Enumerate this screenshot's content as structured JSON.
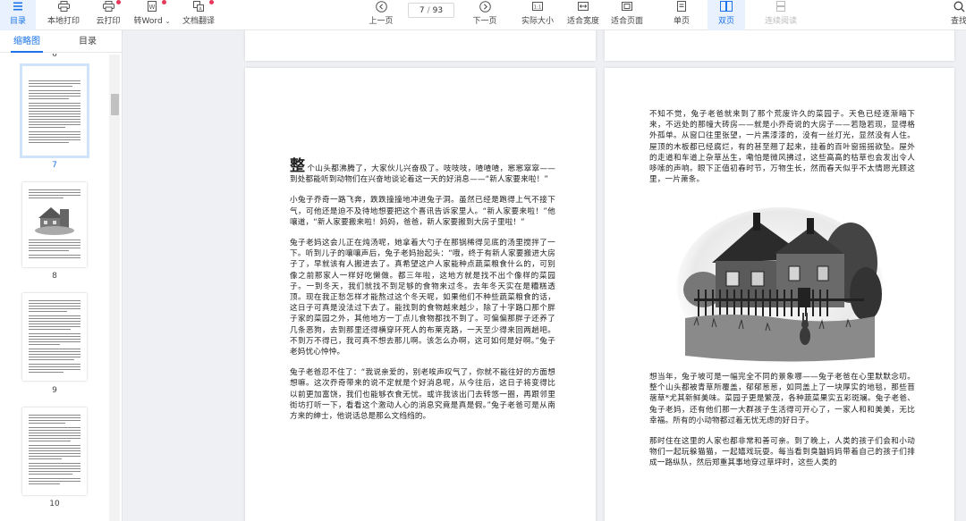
{
  "toolbar": {
    "left_buttons": [
      {
        "label": "目录",
        "icon": "catalog-icon",
        "active": true
      },
      {
        "label": "本地打印",
        "icon": "printer-icon"
      },
      {
        "label": "云打印",
        "icon": "cloud-printer-icon"
      },
      {
        "label": "转Word",
        "icon": "word-icon"
      },
      {
        "label": "文档翻译",
        "icon": "translate-icon"
      }
    ],
    "prev_label": "上一页",
    "next_label": "下一页",
    "current_page": "7",
    "page_sep": "/",
    "total_pages": "93",
    "view_buttons": [
      {
        "label": "实际大小",
        "icon": "actual-size-icon"
      },
      {
        "label": "适合宽度",
        "icon": "fit-width-icon"
      },
      {
        "label": "适合页面",
        "icon": "fit-page-icon"
      },
      {
        "label": "单页",
        "icon": "single-page-icon"
      },
      {
        "label": "双页",
        "icon": "double-page-icon",
        "active": true
      },
      {
        "label": "连续阅读",
        "icon": "continuous-read-icon",
        "disabled": true
      },
      {
        "label": "查找",
        "icon": "search-icon"
      }
    ]
  },
  "sidebar": {
    "tabs": [
      {
        "label": "缩略图",
        "active": true
      },
      {
        "label": "目录"
      }
    ],
    "top_partial_number": "6",
    "thumbnails": [
      {
        "number": "7",
        "selected": true
      },
      {
        "number": "8"
      },
      {
        "number": "9"
      },
      {
        "number": "10"
      }
    ]
  },
  "left_page": {
    "dropcap": "整",
    "paragraphs": [
      "个山头都沸腾了，大家伙儿兴奋极了。吱吱吱，喳喳喳，窸窸窣窣——到处都能听到动物们在兴奋地谈论着这一天的好消息——“新人家要来啦！”",
      "小兔子乔奇一路飞奔，跌跌撞撞地冲进兔子洞。虽然已经是跑得上气不接下气，可他还是迫不及待地想要把这个喜讯告诉家里人。“新人家要来啦！”他嚷道，“新人家要搬来啦！妈妈，爸爸，新人家要搬到大房子里啦！”",
      "兔子老妈这会儿正在炖汤呢，她拿着大勺子在那锅稀得见底的汤里搅拌了一下。听到儿子的嚷嚷声后，兔子老妈抬起头：“哦，终于有新人家要搬进大房子了，早就该有人搬进去了。真希望这户人家能种点蔬菜粮食什么的，可别像之前那家人一样好吃懒做。都三年啦，这地方就是找不出个像样的菜园子。一到冬天，我们就找不到足够的食物来过冬。去年冬天实在是糟糕透顶。现在我正愁怎样才能熬过这个冬天呢，如果他们不种些蔬菜粮食的话，这日子可真是没法过下去了。能找到的食物越来越少，除了十字路口那个胖子家的菜园之外，其他地方一丁点儿食物都找不到了。可偏偏那胖子还养了几条恶狗，去到那里还得横穿环死人的布莱克路，一天至少得来回两趟吧。不到万不得已，我可真不想去那儿啊。该怎么办啊，这可如何是好啊。”兔子老妈忧心忡忡。",
      "兔子老爸忍不住了：“我说亲爱的，别老唉声叹气了，你就不能往好的方面想想嘛。这次乔奇带来的说不定就是个好消息呢，从今往后，这日子将变得比以前更加富饶，我们也能够衣食无忧。或许我该出门去转悠一圈，再跟邻里街坊打听一下，看看这个激动人心的消息究竟是真是假。”兔子老爸可是从南方来的绅士，他说话总是那么文绉绉的。"
    ]
  },
  "right_page": {
    "paragraphs_top": [
      "不知不觉，兔子老爸就来到了那个荒废许久的菜园子。天色已经逐渐暗下来，不远处的那幢大砖房——就是小乔奇说的大房子——若隐若现，显得格外孤单。从窗口往里张望，一片黑漆漆的，没有一丝灯光，显然没有人住。屋顶的木板都已经腐烂，有的甚至翘了起来，挂着的百叶窗摇摇欲坠。屋外的走道和车道上杂草丛生，嘞怕是微风拂过，这些高高的枯草也会发出令人哆嗦的声响。眼下正值初春时节，万物生长，然而春天似乎不太情愿光顾这里，一片萧条。"
    ],
    "paragraphs_bottom": [
      "想当年，兔子坡可是一幅完全不同的景象哪——兔子老爸在心里默默念叨。整个山头都被青草所覆盖，郁郁葱葱，如同盖上了一块厚实的地毯，那些苜蓿草*尤其新鲜美味。菜园子更是繁茂，各种蔬菜果实五彩斑斓。兔子老爸、兔子老妈，还有他们那一大群孩子生活得可开心了，一家人和和美美，无比幸福。所有的小动物都过着无忧无虑的好日子。",
      "那时住在这里的人家也都非常和善可亲。到了晚上，人类的孩子们会和小动物们一起玩躲猫猫，一起嬉戏玩耍。每当看到臭鼬妈妈带着自己的孩子们排成一路纵队，然后郑重其事地穿过草坪时，这些人类的"
    ]
  }
}
